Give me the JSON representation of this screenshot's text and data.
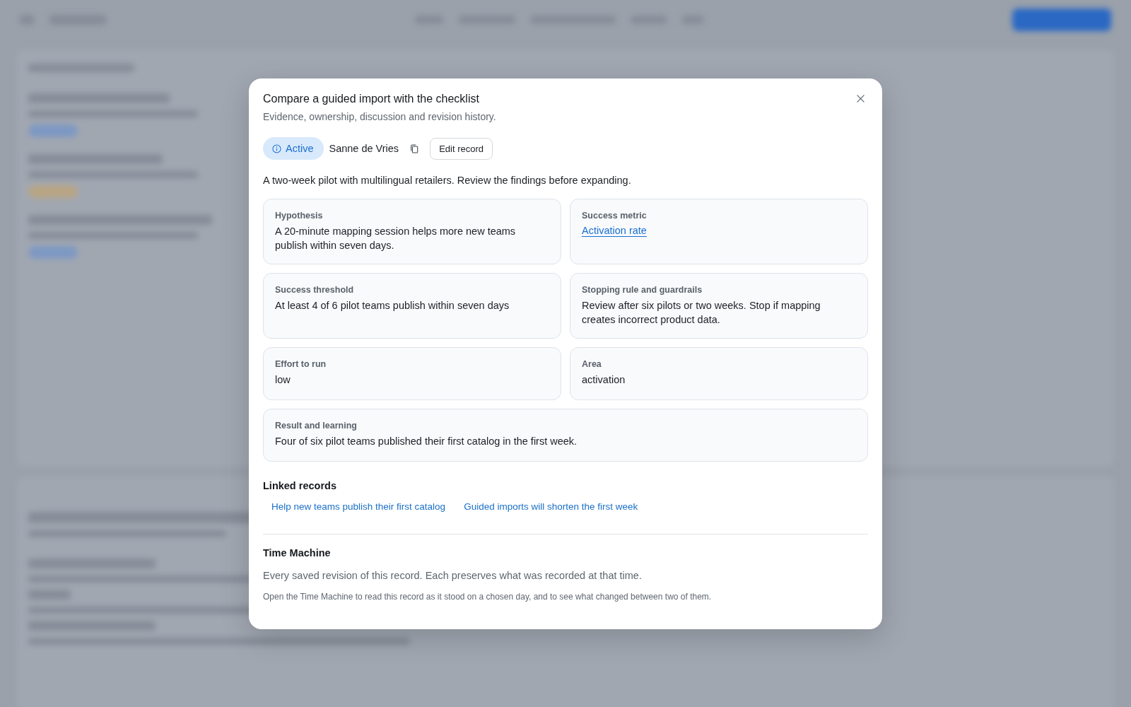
{
  "dialog": {
    "title": "Compare a guided import with the checklist",
    "subtitle": "Evidence, ownership, discussion and revision history.",
    "status": {
      "label": "Active"
    },
    "owner": "Sanne de Vries",
    "edit_button": "Edit record",
    "summary": "A two-week pilot with multilingual retailers. Review the findings before expanding.",
    "fields": [
      {
        "label": "Hypothesis",
        "value": "A 20-minute mapping session helps more new teams publish within seven days.",
        "kind": "text",
        "full_width": false
      },
      {
        "label": "Success metric",
        "value": "Activation rate",
        "kind": "link",
        "full_width": false
      },
      {
        "label": "Success threshold",
        "value": "At least 4 of 6 pilot teams publish within seven days",
        "kind": "text",
        "full_width": false
      },
      {
        "label": "Stopping rule and guardrails",
        "value": "Review after six pilots or two weeks. Stop if mapping creates incorrect product data.",
        "kind": "text",
        "full_width": false
      },
      {
        "label": "Effort to run",
        "value": "low",
        "kind": "text",
        "full_width": false
      },
      {
        "label": "Area",
        "value": "activation",
        "kind": "text",
        "full_width": false
      },
      {
        "label": "Result and learning",
        "value": "Four of six pilot teams published their first catalog in the first week.",
        "kind": "text",
        "full_width": true
      }
    ],
    "linked_records": {
      "heading": "Linked records",
      "links": [
        "Help new teams publish their first catalog",
        "Guided imports will shorten the first week"
      ]
    },
    "time_machine": {
      "heading": "Time Machine",
      "description": "Every saved revision of this record. Each preserves what was recorded at that time.",
      "note": "Open the Time Machine to read this record as it stood on a chosen day, and to see what changed between two of them."
    }
  }
}
